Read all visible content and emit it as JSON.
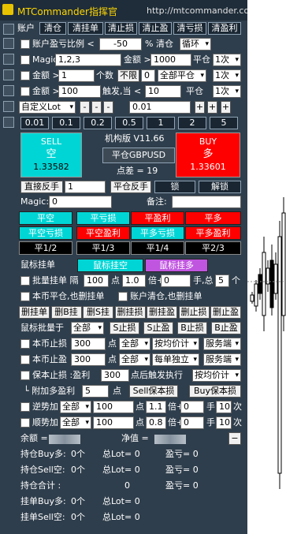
{
  "title": {
    "name": "MTCommander指挥官",
    "url": "http://mtcommander.com"
  },
  "row1": {
    "label": "账户",
    "buttons": [
      "清仓",
      "清挂单",
      "清止损",
      "清止盈",
      "清亏损",
      "清盈利"
    ]
  },
  "row2": {
    "label": "账户盈亏比例 <",
    "value": "-50",
    "pct": "% 清仓",
    "mode": "循环"
  },
  "row3": {
    "label": "Magic",
    "magic": "1,2,3",
    "amount_label": "金额 >",
    "amount": "1000",
    "act": "平仓",
    "times": "1次"
  },
  "row4": {
    "label": "金额 >",
    "value": "1",
    "unit": "个数",
    "nolimit": "不限",
    "zero": "0",
    "scope": "全部平仓",
    "times": "1次"
  },
  "row5": {
    "label": "金额 >",
    "value": "100",
    "trigger": "触发,当 <",
    "tval": "10",
    "act": "平仓",
    "times": "1次"
  },
  "row6": {
    "lot": "自定义Lot",
    "mid": "0.01",
    "pm": [
      "-",
      "-",
      "-",
      "+",
      "+",
      "+"
    ]
  },
  "lots": [
    "0.01",
    "0.1",
    "0.2",
    "0.5",
    "1",
    "2",
    "5"
  ],
  "trade": {
    "sell_label": "SELL",
    "sell_cn": "空",
    "sell_price": "1.33582",
    "buy_label": "BUY",
    "buy_cn": "多",
    "buy_price": "1.33601",
    "version": "机构版 V11.66",
    "symbol_btn": "平仓GBPUSD",
    "spread": "点差 = 19"
  },
  "rev": {
    "direct": "直接反手",
    "dval": "1",
    "close_rev": "平仓反手",
    "lock": "锁",
    "unlock": "解锁"
  },
  "magic_row": {
    "label": "Magic:",
    "value": "0",
    "note_label": "备注:"
  },
  "closebtns": [
    {
      "label": "平空",
      "c": "cyan"
    },
    {
      "label": "平亏损",
      "c": "cyan"
    },
    {
      "label": "平盈利",
      "c": "red"
    },
    {
      "label": "平多",
      "c": "red"
    },
    {
      "label": "平空亏损",
      "c": "cyan"
    },
    {
      "label": "平空盈利",
      "c": "red"
    },
    {
      "label": "平多亏损",
      "c": "cyan"
    },
    {
      "label": "平多盈利",
      "c": "red"
    },
    {
      "label": "平1/2",
      "c": "black"
    },
    {
      "label": "平1/3",
      "c": "black"
    },
    {
      "label": "平1/4",
      "c": "black"
    },
    {
      "label": "平2/3",
      "c": "black"
    }
  ],
  "mouse": {
    "label": "鼠标挂单",
    "sell": "鼠标挂空",
    "buy": "鼠标挂多"
  },
  "batch": {
    "label": "批量挂单 隔",
    "v1": "100",
    "pt": "点",
    "v2": "1.0",
    "step": "倍+",
    "v3": "0",
    "lots": "手,总",
    "v4": "5",
    "unit": "个"
  },
  "chk1": "本币平仓,也删挂单",
  "chk2": "账户清仓,也删挂单",
  "delbtns": [
    "删挂单",
    "删B挂",
    "删S挂",
    "删挂损",
    "删挂盈",
    "删止损",
    "删止盈"
  ],
  "batchmod": {
    "label": "鼠标批量于",
    "scope": "全部",
    "btns": [
      "S止损",
      "S止盈",
      "B止损",
      "B止盈"
    ]
  },
  "sl": {
    "label": "本币止损",
    "v": "300",
    "pt": "点",
    "scope": "全部",
    "calc": "按均价计",
    "srv": "服务端"
  },
  "tp": {
    "label": "本币止盈",
    "v": "300",
    "pt": "点",
    "scope": "全部",
    "calc": "每单独立",
    "srv": "服务端"
  },
  "be": {
    "label": "保本止损 :盈利",
    "v": "300",
    "after": "点后触发执行",
    "calc": "按均价计"
  },
  "addbe": {
    "label": "附加多盈利",
    "v": "5",
    "pt": "点",
    "sell": "Sell保本损",
    "buy": "Buy保本损"
  },
  "rev_add": {
    "label": "逆势加",
    "scope": "全部",
    "v": "100",
    "pt": "点",
    "mult": "1.1",
    "plus": "倍+",
    "v2": "0",
    "hand": "手",
    "cnt": "10",
    "ci": "次"
  },
  "pro_add": {
    "label": "顺势加",
    "scope": "全部",
    "v": "100",
    "pt": "点",
    "mult": "0.8",
    "plus": "倍+",
    "v2": "0",
    "hand": "手",
    "cnt": "10",
    "ci": "次"
  },
  "stats": {
    "balance": "余额 =",
    "equity": "净值 =",
    "rows": [
      {
        "a": "持仓Buy多:",
        "b": "0个",
        "c": "总Lot= 0",
        "d": "盈亏= 0"
      },
      {
        "a": "持仓Sell空:",
        "b": "0个",
        "c": "总Lot= 0",
        "d": "盈亏= 0"
      },
      {
        "a": "持仓合计 :",
        "b": "",
        "c": "0",
        "d": "盈亏= 0"
      },
      {
        "a": "挂单Buy多:",
        "b": "0个",
        "c": "总Lot= 0",
        "d": ""
      },
      {
        "a": "挂单Sell空:",
        "b": "0个",
        "c": "总Lot= 0",
        "d": ""
      }
    ]
  }
}
